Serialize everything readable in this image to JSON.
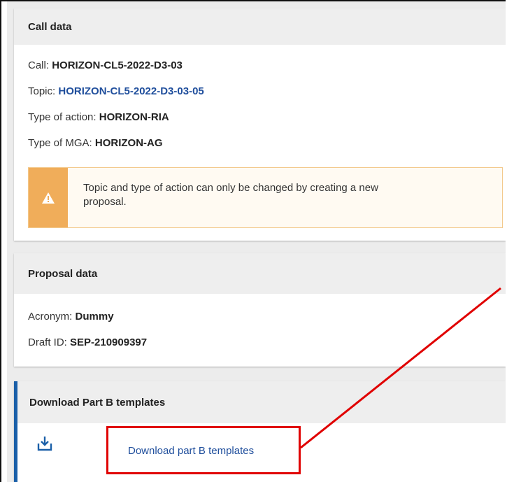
{
  "call_data": {
    "header": "Call data",
    "call_label": "Call:",
    "call_value": "HORIZON-CL5-2022-D3-03",
    "topic_label": "Topic:",
    "topic_value": "HORIZON-CL5-2022-D3-03-05",
    "type_action_label": "Type of action:",
    "type_action_value": "HORIZON-RIA",
    "type_mga_label": "Type of MGA:",
    "type_mga_value": "HORIZON-AG",
    "warning_line1": "Topic and type of action can only be changed by creating a new",
    "warning_line2": "proposal."
  },
  "proposal_data": {
    "header": "Proposal data",
    "acronym_label": "Acronym:",
    "acronym_value": "Dummy",
    "draft_label": "Draft ID:",
    "draft_value": "SEP-210909397"
  },
  "download": {
    "header": "Download Part B templates",
    "link_label": "Download part B templates",
    "icon": "download-icon"
  },
  "colors": {
    "link": "#1f4e9c",
    "accent": "#1a5fa8",
    "warning": "#f0ad5a",
    "annotation": "#e00000"
  }
}
